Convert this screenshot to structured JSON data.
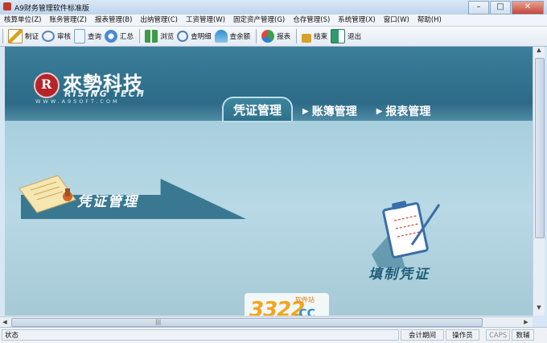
{
  "window": {
    "title": "A9财务管理软件标准版",
    "btn_min": "–",
    "btn_max": "□",
    "btn_close": "✕"
  },
  "menu": [
    {
      "label": "核算单位(Z)"
    },
    {
      "label": "账务管理(Z)"
    },
    {
      "label": "报表管理(B)"
    },
    {
      "label": "出纳管理(C)"
    },
    {
      "label": "工资管理(W)"
    },
    {
      "label": "固定资产管理(G)"
    },
    {
      "label": "仓存管理(S)"
    },
    {
      "label": "系统管理(X)"
    },
    {
      "label": "窗口(W)"
    },
    {
      "label": "帮助(H)"
    }
  ],
  "toolbar": [
    {
      "label": "制证",
      "icon": "pen-icon",
      "color": "#d8a21a"
    },
    {
      "label": "审核",
      "icon": "glasses-icon",
      "color": "#5b86b8"
    },
    {
      "label": "查询",
      "icon": "document-icon",
      "color": "#7aa0c8"
    },
    {
      "label": "汇总",
      "icon": "sum-icon",
      "color": "#4a8ad0"
    },
    {
      "label": "浏览",
      "icon": "book-icon",
      "color": "#3d9a4a"
    },
    {
      "label": "查明细",
      "icon": "magnifier-icon",
      "color": "#4f7fb8"
    },
    {
      "label": "查余额",
      "icon": "chart-icon",
      "color": "#2f8fd0"
    },
    {
      "label": "报表",
      "icon": "pie-icon",
      "color": "#3aa050"
    },
    {
      "label": "结束",
      "icon": "lock-icon",
      "color": "#d6a12a"
    },
    {
      "label": "退出",
      "icon": "exit-icon",
      "color": "#2f9a6e"
    }
  ],
  "brand": {
    "cn": "來勢科技",
    "en": "RISING TECH",
    "url": "WWW.A9SOFT.COM"
  },
  "tabs": {
    "active": "凭证管理",
    "items": [
      "账簿管理",
      "报表管理"
    ]
  },
  "section": {
    "title": "凭证管理"
  },
  "entry": {
    "label": "填制凭证"
  },
  "watermark": {
    "num": "3322",
    "tag": "软件站",
    "domain": ".CC"
  },
  "status": {
    "left": "状态",
    "period": "会计期间",
    "operator": "操作员",
    "caps": "CAPS",
    "num": "数辅"
  },
  "colors": {
    "brand_red": "#b6232a",
    "header": "#2f6f8b",
    "accent": "#3a7892"
  }
}
